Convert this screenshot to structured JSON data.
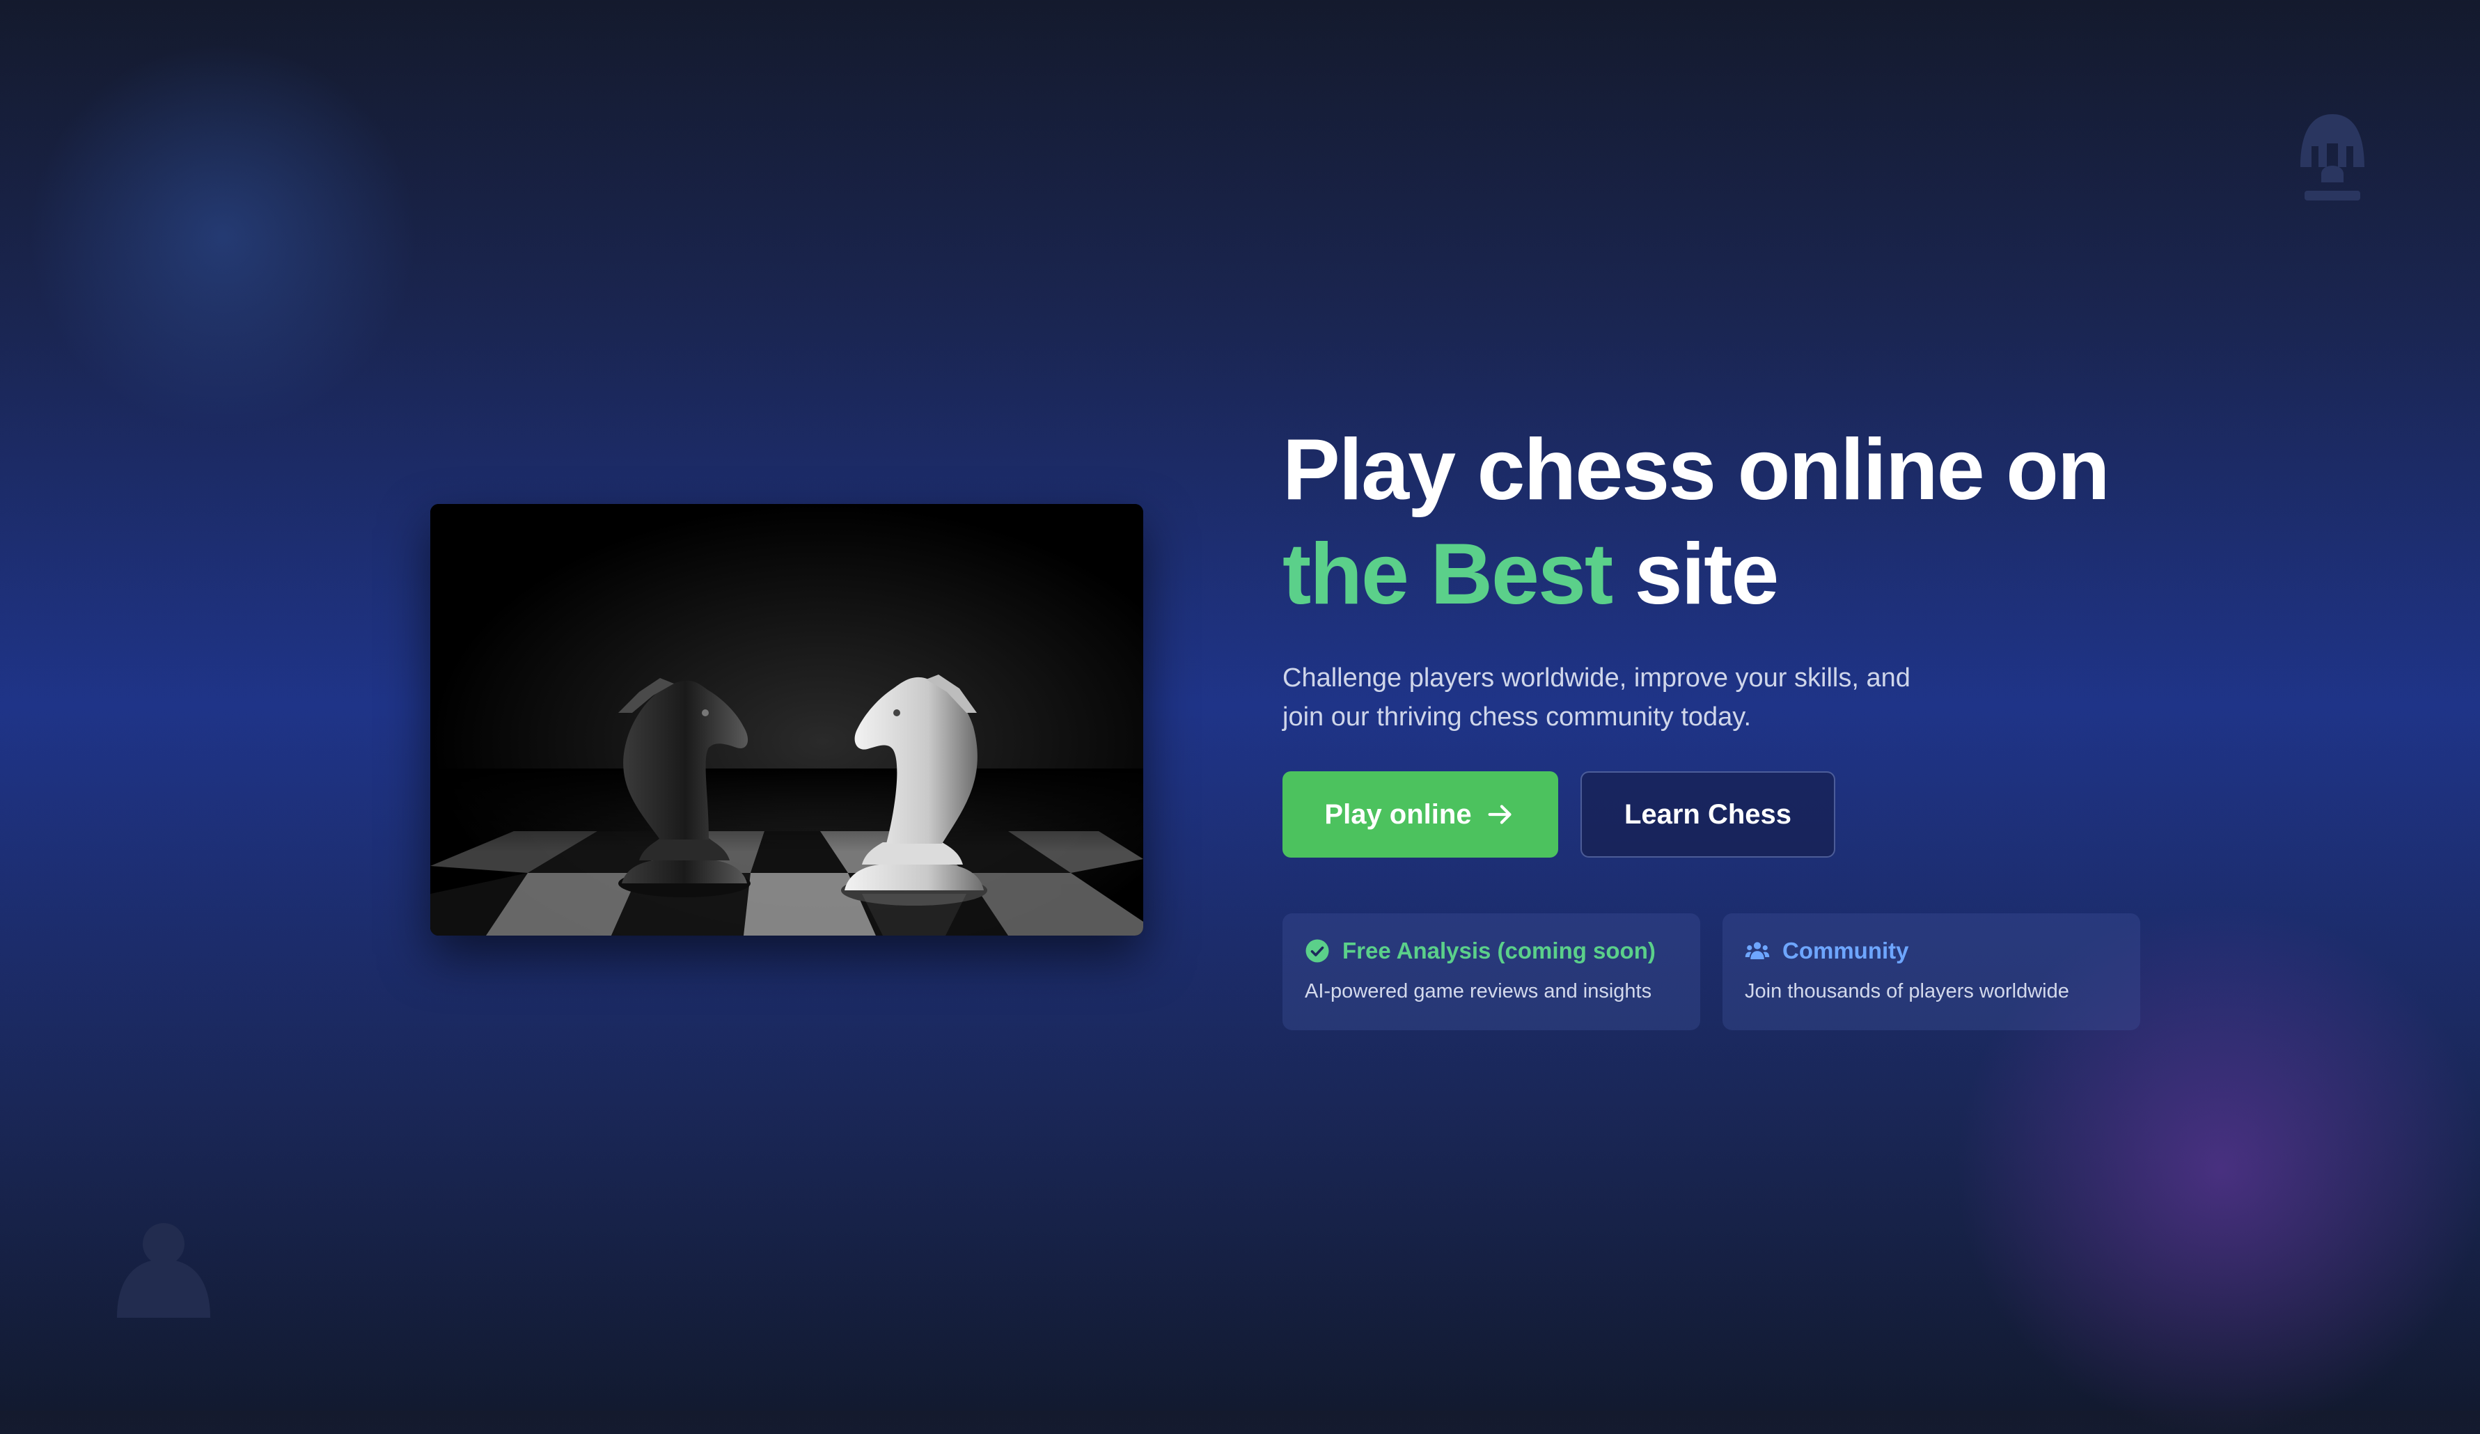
{
  "hero": {
    "headline_line1": "Play chess online on",
    "headline_accent": "the Best",
    "headline_rest": "site",
    "subtitle": "Challenge players worldwide, improve your skills, and join our thriving chess community today."
  },
  "buttons": {
    "play_label": "Play online",
    "learn_label": "Learn Chess"
  },
  "features": [
    {
      "title": "Free Analysis (coming soon)",
      "description": "AI-powered game reviews and insights",
      "icon": "check-circle-icon",
      "color": "#5bd08a"
    },
    {
      "title": "Community",
      "description": "Join thousands of players worldwide",
      "icon": "users-icon",
      "color": "#6ea6ff"
    }
  ],
  "colors": {
    "accent_green": "#5bd08a",
    "primary_button": "#4cc25e",
    "community_blue": "#6ea6ff"
  },
  "icons": {
    "decor_top_right": "rook-icon",
    "decor_bottom_left": "pawn-icon",
    "play_arrow": "arrow-right-icon"
  }
}
